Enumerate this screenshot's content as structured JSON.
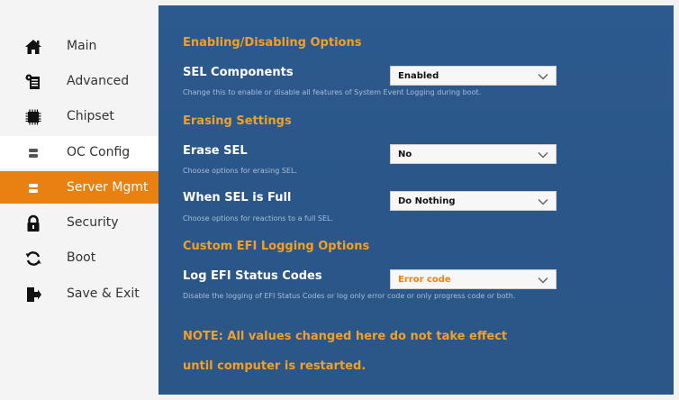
{
  "sidebar": {
    "items": [
      {
        "label": "Main",
        "icon": "home-icon"
      },
      {
        "label": "Advanced",
        "icon": "advanced-icon"
      },
      {
        "label": "Chipset",
        "icon": "chip-icon"
      },
      {
        "label": "OC Config",
        "icon": "oc-config-icon"
      },
      {
        "label": "Server Mgmt",
        "icon": "server-icon"
      },
      {
        "label": "Security",
        "icon": "lock-icon"
      },
      {
        "label": "Boot",
        "icon": "refresh-icon"
      },
      {
        "label": "Save & Exit",
        "icon": "exit-icon"
      }
    ]
  },
  "main": {
    "sections": {
      "enabling": "Enabling/Disabling Options",
      "erasing": "Erasing Settings",
      "custom": "Custom EFI Logging Options"
    },
    "settings": {
      "sel_components": {
        "label": "SEL Components",
        "value": "Enabled",
        "help": "Change this to enable or disable all features of System Event Logging during boot."
      },
      "erase_sel": {
        "label": "Erase SEL",
        "value": "No",
        "help": "Choose options for erasing SEL."
      },
      "when_sel_full": {
        "label": "When SEL is Full",
        "value": "Do Nothing",
        "help": "Choose options for reactions to a full SEL."
      },
      "log_efi_status": {
        "label": "Log EFI Status Codes",
        "value": "Error code",
        "help": "Disable the logging of EFI Status Codes or log only error code or only progress code or both."
      }
    },
    "note_line1": "NOTE: All values changed here do not take effect",
    "note_line2": "until computer is restarted."
  },
  "colors": {
    "accent": "#e98012",
    "panel_blue": "#2d5a8e",
    "section_text": "#f0a02a"
  }
}
